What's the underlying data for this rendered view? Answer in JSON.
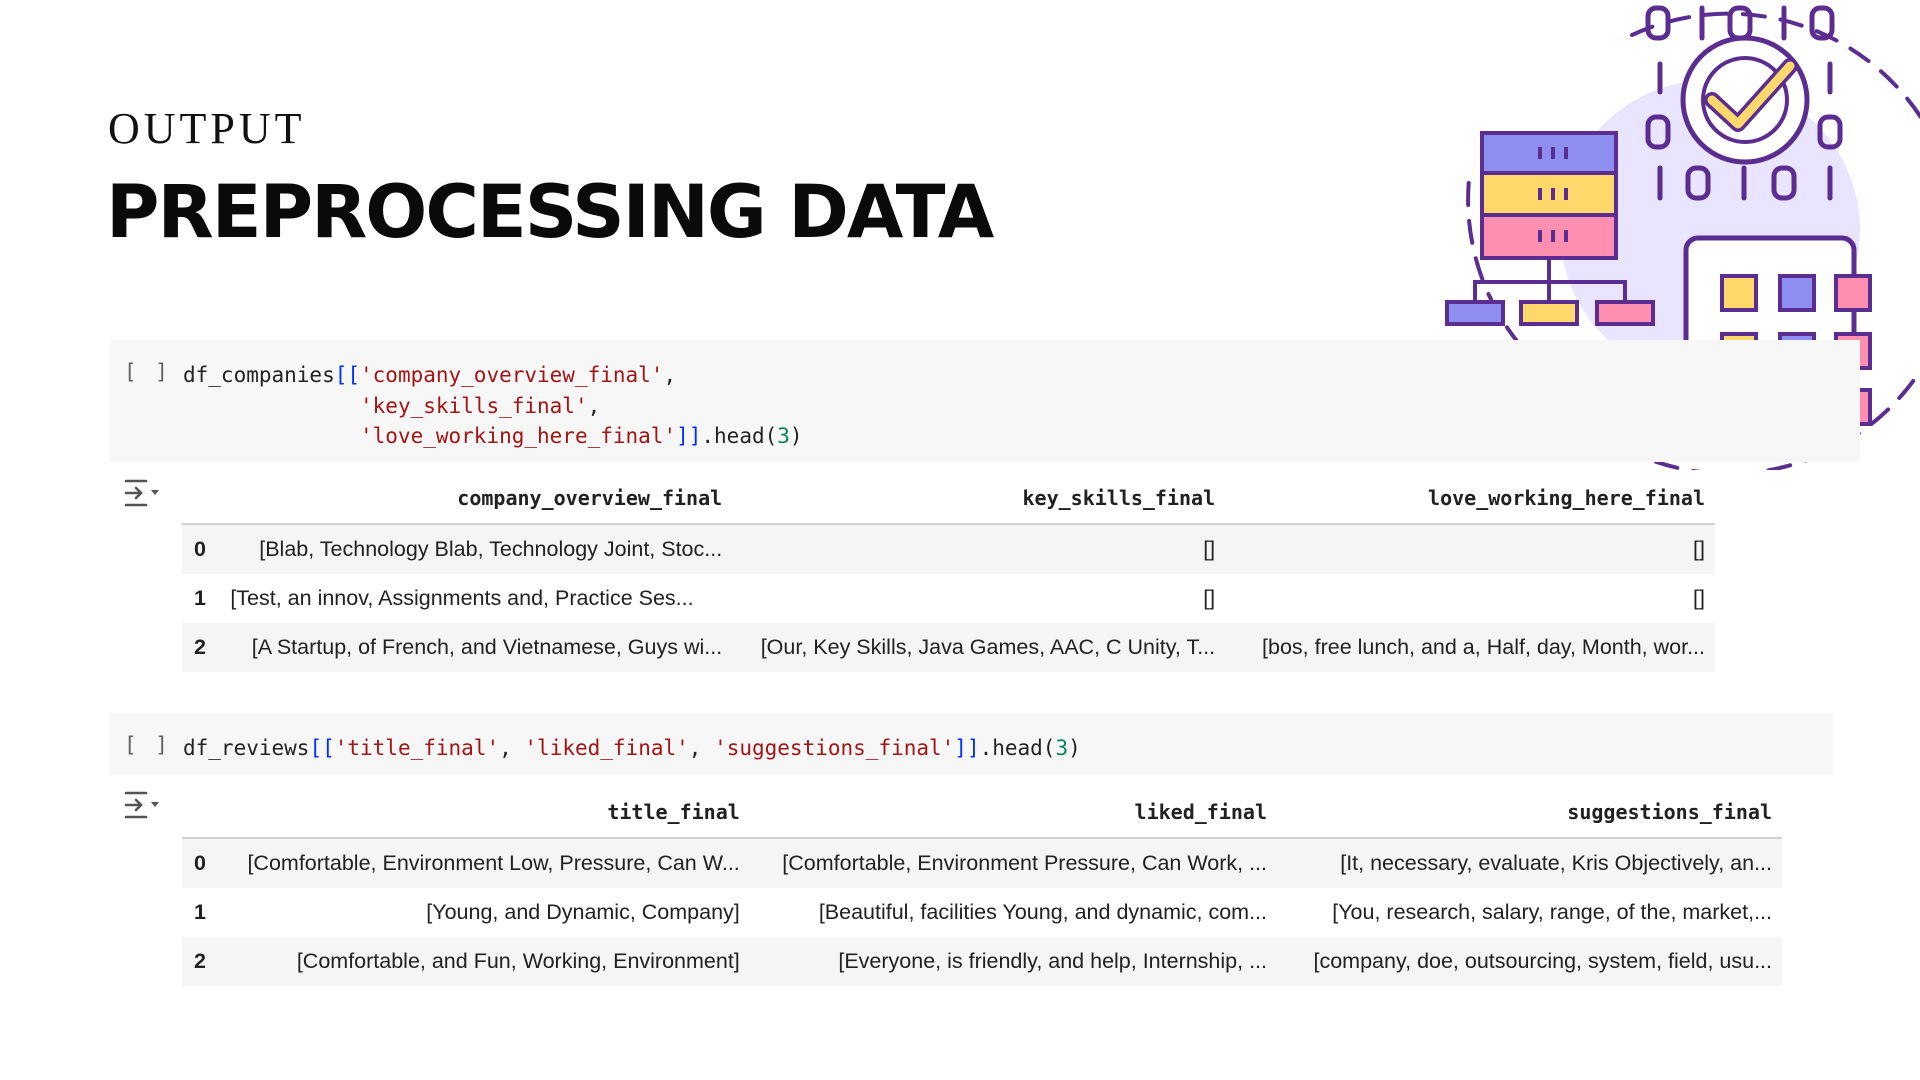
{
  "slide": {
    "subtitle": "OUTPUT",
    "title": "PREPROCESSING DATA"
  },
  "cell1": {
    "run_label": "[ ]",
    "lines": [
      [
        "df_companies",
        "[[",
        "'company_overview_final'",
        ","
      ],
      [
        "'key_skills_final'",
        ","
      ],
      [
        "'love_working_here_final'",
        "]]",
        ".head(",
        "3",
        ")"
      ]
    ],
    "code_text": "df_companies[['company_overview_final',\n              'key_skills_final',\n              'love_working_here_final']].head(3)"
  },
  "table1": {
    "columns": [
      "company_overview_final",
      "key_skills_final",
      "love_working_here_final"
    ],
    "rows": [
      {
        "index": "0",
        "cells": [
          "[Blab, Technology Blab, Technology Joint, Stoc...",
          "[]",
          "[]"
        ]
      },
      {
        "index": "1",
        "cells": [
          "[Test, an innov, Assignments and, Practice Ses...",
          "[]",
          "[]"
        ]
      },
      {
        "index": "2",
        "cells": [
          "[A Startup, of French, and Vietnamese, Guys wi...",
          "[Our, Key Skills, Java Games, AAC, C Unity, T...",
          "[bos, free lunch, and a, Half, day, Month, wor..."
        ]
      }
    ]
  },
  "cell2": {
    "run_label": "[ ]",
    "code_text": "df_reviews[['title_final', 'liked_final', 'suggestions_final']].head(3)"
  },
  "table2": {
    "columns": [
      "title_final",
      "liked_final",
      "suggestions_final"
    ],
    "rows": [
      {
        "index": "0",
        "cells": [
          "[Comfortable, Environment Low, Pressure, Can W...",
          "[Comfortable, Environment Pressure, Can Work, ...",
          "[It, necessary, evaluate, Kris Objectively, an..."
        ]
      },
      {
        "index": "1",
        "cells": [
          "[Young, and Dynamic, Company]",
          "[Beautiful, facilities Young, and dynamic, com...",
          "[You, research, salary, range, of the, market,..."
        ]
      },
      {
        "index": "2",
        "cells": [
          "[Comfortable, and Fun, Working, Environment]",
          "[Everyone, is friendly, and help, Internship, ...",
          "[company, doe, outsourcing, system, field, usu..."
        ]
      }
    ]
  },
  "icons": {
    "output_toggle": "output-toggle-icon",
    "illustration": "data-processing-illustration"
  },
  "colors": {
    "accent_purple": "#5b2d91",
    "blue": "#8e8ef0",
    "yellow": "#ffd86b",
    "pink": "#ff8fb1",
    "lavender": "#e9e4ff"
  }
}
